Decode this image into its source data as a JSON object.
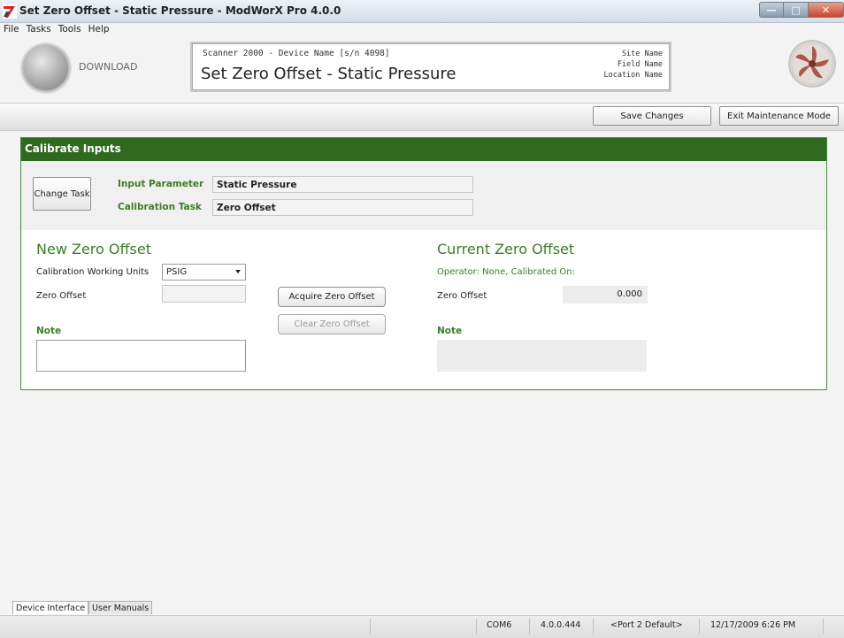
{
  "window": {
    "title": "Set Zero Offset - Static Pressure - ModWorX Pro 4.0.0"
  },
  "menu": [
    "File",
    "Tasks",
    "Tools",
    "Help"
  ],
  "header": {
    "download_label": "DOWNLOAD",
    "device_line": "Scanner 2000 - Device Name [s/n 4098]",
    "page_title": "Set Zero Offset - Static Pressure",
    "site_name": "Site Name",
    "field_name": "Field Name",
    "location_name": "Location Name"
  },
  "toolbar": {
    "save_label": "Save Changes",
    "exit_label": "Exit Maintenance Mode"
  },
  "panel": {
    "title": "Calibrate Inputs",
    "change_task_label": "Change Task",
    "input_parameter_label": "Input Parameter",
    "input_parameter_value": "Static Pressure",
    "calibration_task_label": "Calibration Task",
    "calibration_task_value": "Zero Offset"
  },
  "new_offset": {
    "title": "New Zero Offset",
    "units_label": "Calibration Working Units",
    "units_value": "PSIG",
    "zero_offset_label": "Zero Offset",
    "zero_offset_value": "",
    "note_label": "Note",
    "note_value": ""
  },
  "actions": {
    "acquire_label": "Acquire Zero Offset",
    "clear_label": "Clear Zero Offset"
  },
  "current_offset": {
    "title": "Current Zero Offset",
    "operator_line": "Operator: None, Calibrated On:",
    "zero_offset_label": "Zero Offset",
    "zero_offset_value": "0.000",
    "note_label": "Note",
    "note_value": ""
  },
  "tabs": [
    "Device Interface",
    "User Manuals"
  ],
  "status": {
    "port": "COM6",
    "version": "4.0.0.444",
    "port_default": "<Port 2 Default>",
    "datetime": "12/17/2009 6:26 PM"
  },
  "colors": {
    "accent_green": "#2f6a1f",
    "label_green": "#3b7d23"
  },
  "icons": [
    "app-logo-icon",
    "minimize-icon",
    "maximize-icon",
    "close-icon",
    "download-orb-icon",
    "fan-logo-icon",
    "dropdown-caret-icon"
  ]
}
